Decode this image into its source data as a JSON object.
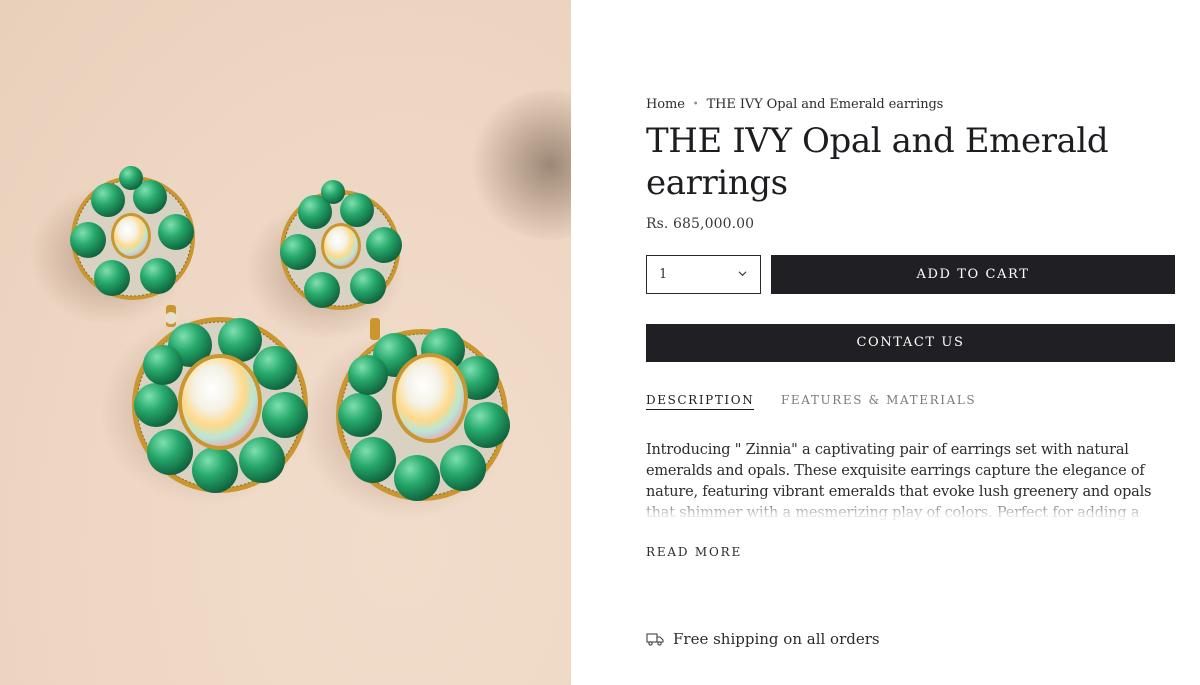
{
  "breadcrumb": {
    "home": "Home",
    "separator": "•",
    "current": "THE IVY Opal and Emerald earrings"
  },
  "product": {
    "title": "THE IVY Opal and Emerald earrings",
    "price": "Rs. 685,000.00",
    "quantity": "1",
    "add_to_cart": "ADD TO CART",
    "contact_us": "CONTACT US",
    "image_icon": "earrings-photo"
  },
  "tabs": [
    {
      "label": "DESCRIPTION",
      "active": true
    },
    {
      "label": "FEATURES & MATERIALS",
      "active": false
    }
  ],
  "description": "Introducing \" Zinnia\" a captivating pair of earrings set with natural emeralds and opals. These exquisite earrings capture the elegance of nature, featuring vibrant emeralds that evoke lush greenery and opals that shimmer with a mesmerizing play of colors. Perfect for adding a touch of sophistication and natural beauty to any ensemble, \"Zinnia\" is a timeless jewel",
  "read_more": "READ MORE",
  "shipping": {
    "icon": "truck-icon",
    "text": "Free shipping on all orders"
  },
  "colors": {
    "button_bg": "#202024",
    "button_text": "#ffffff",
    "image_bg": "#efd9c6",
    "emerald": "#1f9b61",
    "gold": "#c9962f"
  }
}
